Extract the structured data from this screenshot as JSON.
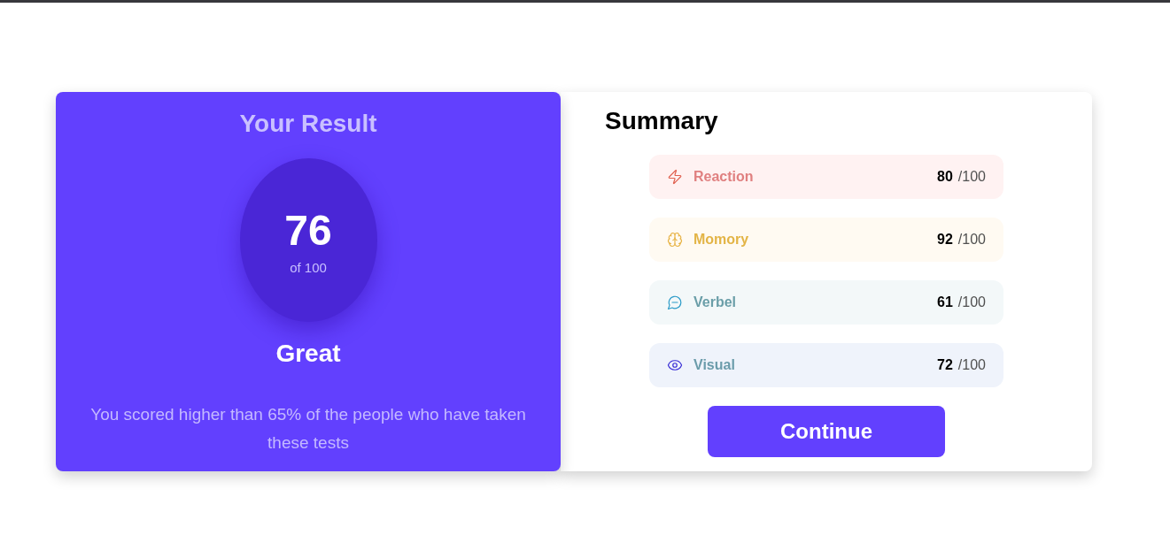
{
  "result": {
    "title": "Your Result",
    "score": "76",
    "total": "of 100",
    "rating": "Great",
    "description": "You scored higher than 65% of the people who have taken these tests"
  },
  "summary": {
    "title": "Summary",
    "items": [
      {
        "kind": "reaction",
        "label": "Reaction",
        "color": "#e08080",
        "score": "80",
        "total": "/100"
      },
      {
        "kind": "memory",
        "label": "Momory",
        "color": "#e3b446",
        "score": "92",
        "total": "/100"
      },
      {
        "kind": "verbal",
        "label": "Verbel",
        "color": "#6a9ea8",
        "score": "61",
        "total": "/100"
      },
      {
        "kind": "visual",
        "label": "Visual",
        "color": "#6b9cab",
        "score": "72",
        "total": "/100"
      }
    ],
    "button": "Continue"
  }
}
